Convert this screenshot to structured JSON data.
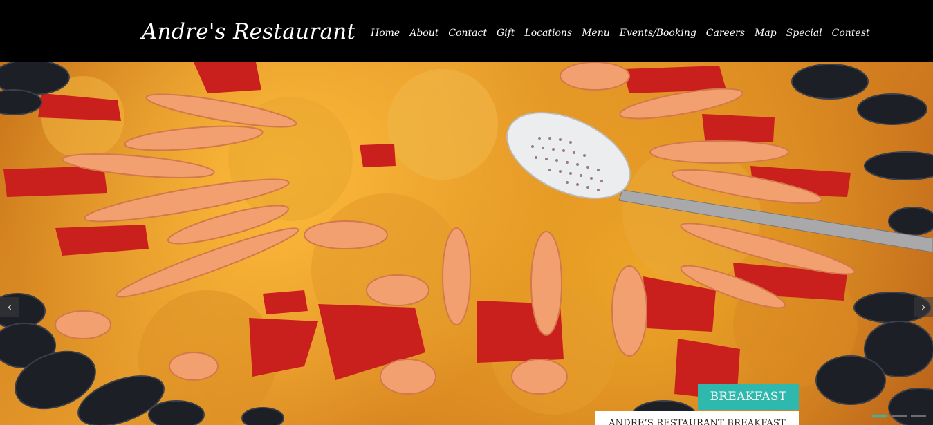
{
  "header": {
    "logo": "Andre's Restaurant",
    "nav": [
      {
        "label": "Home"
      },
      {
        "label": "About"
      },
      {
        "label": "Contact"
      },
      {
        "label": "Gift"
      },
      {
        "label": "Locations"
      },
      {
        "label": "Menu"
      },
      {
        "label": "Events/Booking"
      },
      {
        "label": "Careers"
      },
      {
        "label": "Map"
      },
      {
        "label": "Special"
      },
      {
        "label": "Contest"
      }
    ]
  },
  "slider": {
    "caption_title": "BREAKFAST",
    "caption_subtitle": "ANDRE’S RESTAURANT BREAKFAST",
    "prev_icon": "chevron-left-icon",
    "next_icon": "chevron-right-icon",
    "slide_count": 3,
    "active_slide": 1
  },
  "colors": {
    "header_bg": "#000000",
    "accent": "#2fb9ae"
  }
}
